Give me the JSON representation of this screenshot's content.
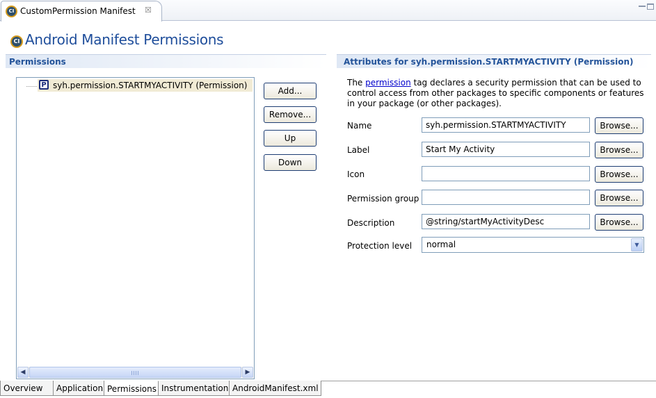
{
  "editor_tab": {
    "icon": "ci-icon",
    "title": "CustomPermission Manifest",
    "close_glyph": "☒"
  },
  "header": {
    "title": "Android Manifest Permissions",
    "icon": "ci-icon"
  },
  "permissions_panel": {
    "heading": "Permissions",
    "tree_items": [
      {
        "icon_letter": "P",
        "label": "syh.permission.STARTMYACTIVITY (Permission)",
        "selected": true
      }
    ],
    "buttons": {
      "add": "Add...",
      "remove": "Remove...",
      "up": "Up",
      "down": "Down"
    },
    "scrollbar": {
      "left_arrow": "◀",
      "right_arrow": "▶"
    }
  },
  "attributes_panel": {
    "heading": "Attributes for syh.permission.STARTMYACTIVITY (Permission)",
    "description": {
      "prefix": "The ",
      "link": "permission",
      "suffix": " tag declares a security permission that can be used to control access from other packages to specific components or features in your package (or other packages)."
    },
    "browse_label": "Browse...",
    "fields": {
      "name": {
        "label": "Name",
        "value": "syh.permission.STARTMYACTIVITY"
      },
      "label": {
        "label": "Label",
        "value": "Start My Activity"
      },
      "icon": {
        "label": "Icon",
        "value": ""
      },
      "permission_group": {
        "label": "Permission group",
        "value": ""
      },
      "description": {
        "label": "Description",
        "value": "@string/startMyActivityDesc"
      }
    },
    "protection_level": {
      "label": "Protection level",
      "value": "normal",
      "arrow": "▼"
    }
  },
  "page_tabs": [
    {
      "label": "Overview",
      "active": false
    },
    {
      "label": "Application",
      "active": false
    },
    {
      "label": "Permissions",
      "active": true
    },
    {
      "label": "Instrumentation",
      "active": false
    },
    {
      "label": "AndroidManifest.xml",
      "active": false
    }
  ],
  "colors": {
    "title_blue": "#1f4e9b",
    "section_heading": "#24549a",
    "selection_bg": "#f1ebd5",
    "link": "#0000cc"
  }
}
